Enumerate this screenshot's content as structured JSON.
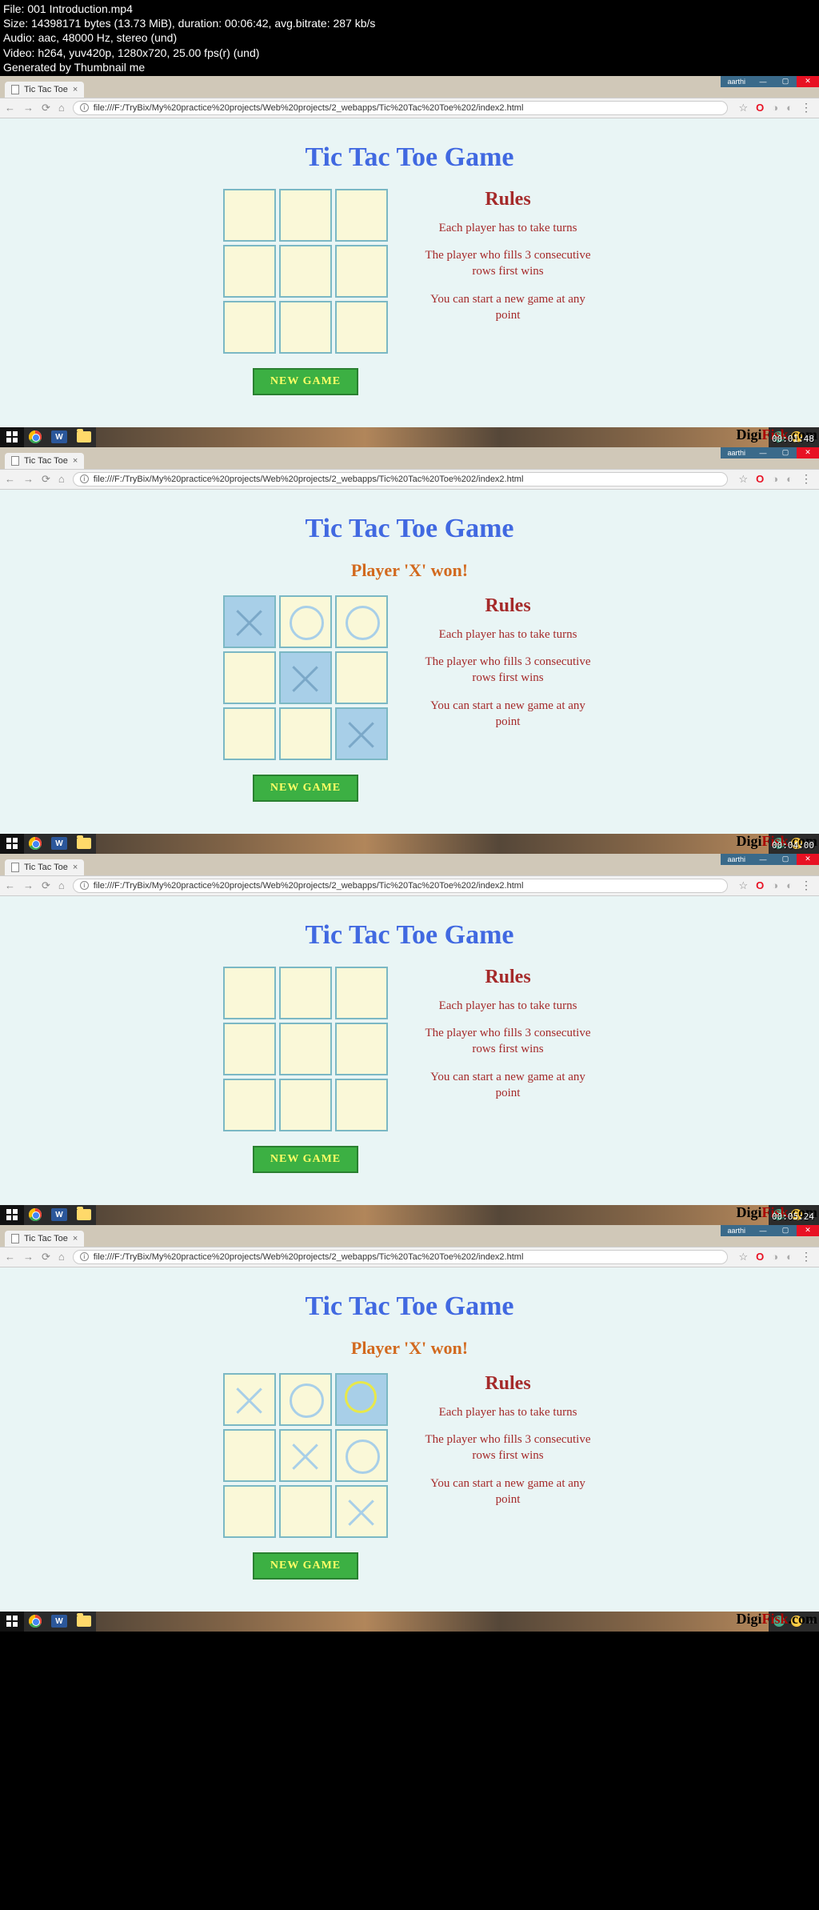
{
  "meta": {
    "line1": "File: 001 Introduction.mp4",
    "line2": "Size: 14398171 bytes (13.73 MiB), duration: 00:06:42, avg.bitrate: 287 kb/s",
    "line3": "Audio: aac, 48000 Hz, stereo (und)",
    "line4": "Video: h264, yuv420p, 1280x720, 25.00 fps(r) (und)",
    "line5": "Generated by Thumbnail me"
  },
  "browser": {
    "tab_title": "Tic Tac Toe",
    "url": "file:///F:/TryBix/My%20practice%20projects/Web%20projects/2_webapps/Tic%20Tac%20Toe%202/index2.html",
    "user": "aarthi"
  },
  "watermark": "DigiFisk.com",
  "game": {
    "title": "Tic Tac Toe Game",
    "win_msg": "Player 'X' won!",
    "new_game": "NEW GAME",
    "rules_h": "Rules",
    "rule1": "Each player has to take turns",
    "rule2": "The player who fills 3 consecutive rows first wins",
    "rule3": "You can start a new game at any point"
  },
  "timestamps": {
    "p2": "00:01:48",
    "p3": "00:04:00",
    "p4": "00:05:24"
  },
  "word_ic": "W"
}
